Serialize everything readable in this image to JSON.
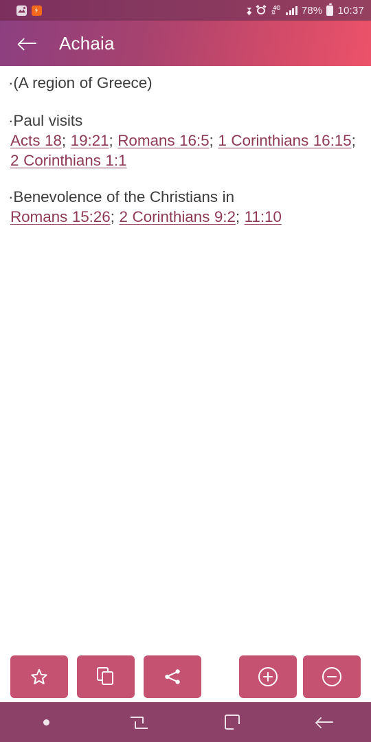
{
  "status_bar": {
    "notifications": [
      {
        "icon": "gallery-icon"
      },
      {
        "icon": "orange-app-icon"
      }
    ],
    "icons": [
      "bluetooth-icon",
      "alarm-icon",
      "4g-network-icon",
      "signal-bars-icon"
    ],
    "battery_percent": "78%",
    "battery_icon": "battery-full-icon",
    "time": "10:37"
  },
  "app_bar": {
    "back_icon": "back-arrow-icon",
    "title": "Achaia",
    "gradient_start": "#8c3f80",
    "gradient_end": "#ec5269"
  },
  "content": {
    "link_color": "#8f3a54",
    "text_color": "#3d3d3d",
    "sections": [
      {
        "bullet": "·",
        "heading": "(A region of Greece)",
        "refs": []
      },
      {
        "bullet": "·",
        "heading": "Paul visits",
        "refs": [
          "Acts 18",
          "19:21",
          "Romans 16:5",
          "1 Corinthians 16:15",
          "2 Corinthians 1:1"
        ],
        "separator": "; "
      },
      {
        "bullet": "·",
        "heading": "Benevolence of the Christians in",
        "refs": [
          "Romans 15:26",
          "2 Corinthians 9:2",
          "11:10"
        ],
        "separator": "; "
      }
    ]
  },
  "toolbar": {
    "button_color": "#c45270",
    "buttons_left": [
      {
        "name": "favorite-button",
        "icon": "star-icon"
      },
      {
        "name": "copy-button",
        "icon": "copy-icon"
      },
      {
        "name": "share-button",
        "icon": "share-icon"
      }
    ],
    "buttons_right": [
      {
        "name": "zoom-in-button",
        "icon": "plus-circle-icon"
      },
      {
        "name": "zoom-out-button",
        "icon": "minus-circle-icon"
      }
    ]
  },
  "nav_bar": {
    "background": "#8c4268",
    "items": [
      {
        "name": "nav-dot",
        "icon": "dot-icon"
      },
      {
        "name": "nav-recents",
        "icon": "recents-icon"
      },
      {
        "name": "nav-home",
        "icon": "home-square-icon"
      },
      {
        "name": "nav-back",
        "icon": "back-arrow-icon"
      }
    ]
  }
}
